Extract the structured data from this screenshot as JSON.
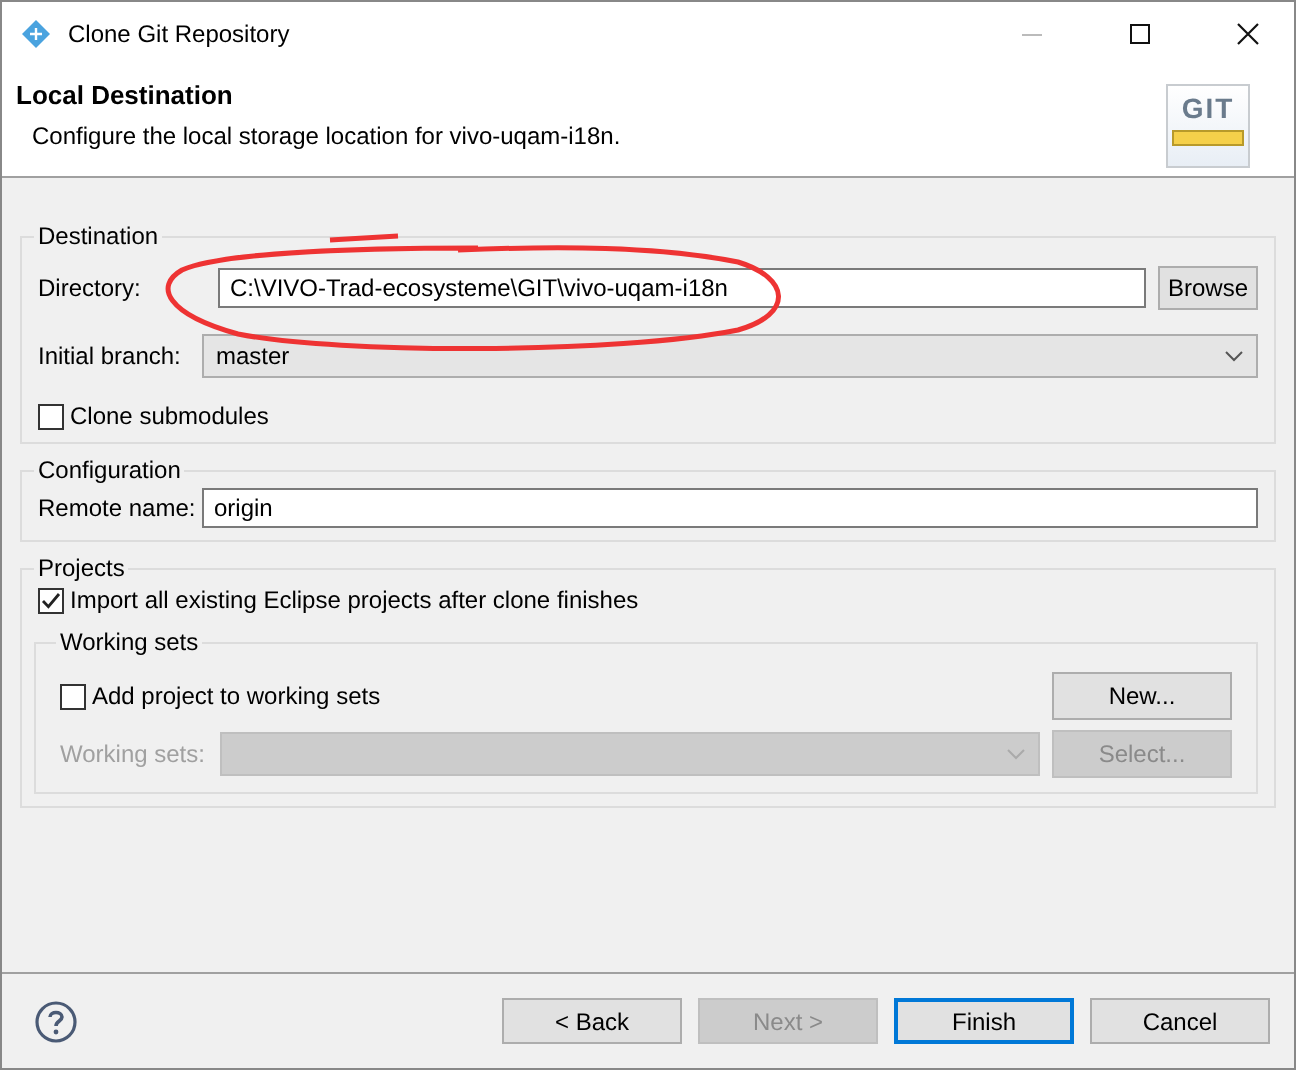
{
  "window": {
    "title": "Clone Git Repository"
  },
  "header": {
    "title": "Local Destination",
    "description": "Configure the local storage location for vivo-uqam-i18n.",
    "logo_text": "GIT"
  },
  "destination": {
    "legend": "Destination",
    "directory_label": "Directory:",
    "directory": "C:\\VIVO-Trad-ecosysteme\\GIT\\vivo-uqam-i18n",
    "browse": "Browse",
    "branch_label": "Initial branch:",
    "branch": "master",
    "clone_submodules": {
      "label": "Clone submodules",
      "checked": false
    }
  },
  "configuration": {
    "legend": "Configuration",
    "remote_label": "Remote name:",
    "remote": "origin"
  },
  "projects": {
    "legend": "Projects",
    "import_projects": {
      "label": "Import all existing Eclipse projects after clone finishes",
      "checked": true
    },
    "working_sets": {
      "legend": "Working sets",
      "add_to_sets": {
        "label": "Add project to working sets",
        "checked": false
      },
      "new_button": "New...",
      "sets_label": "Working sets:",
      "disabled": true,
      "select_button": "Select..."
    }
  },
  "buttons": [
    {
      "label": "< Back",
      "disabled": false,
      "default": false
    },
    {
      "label": "Next >",
      "disabled": true,
      "default": false
    },
    {
      "label": "Finish",
      "disabled": false,
      "default": true
    },
    {
      "label": "Cancel",
      "disabled": false,
      "default": false
    }
  ]
}
